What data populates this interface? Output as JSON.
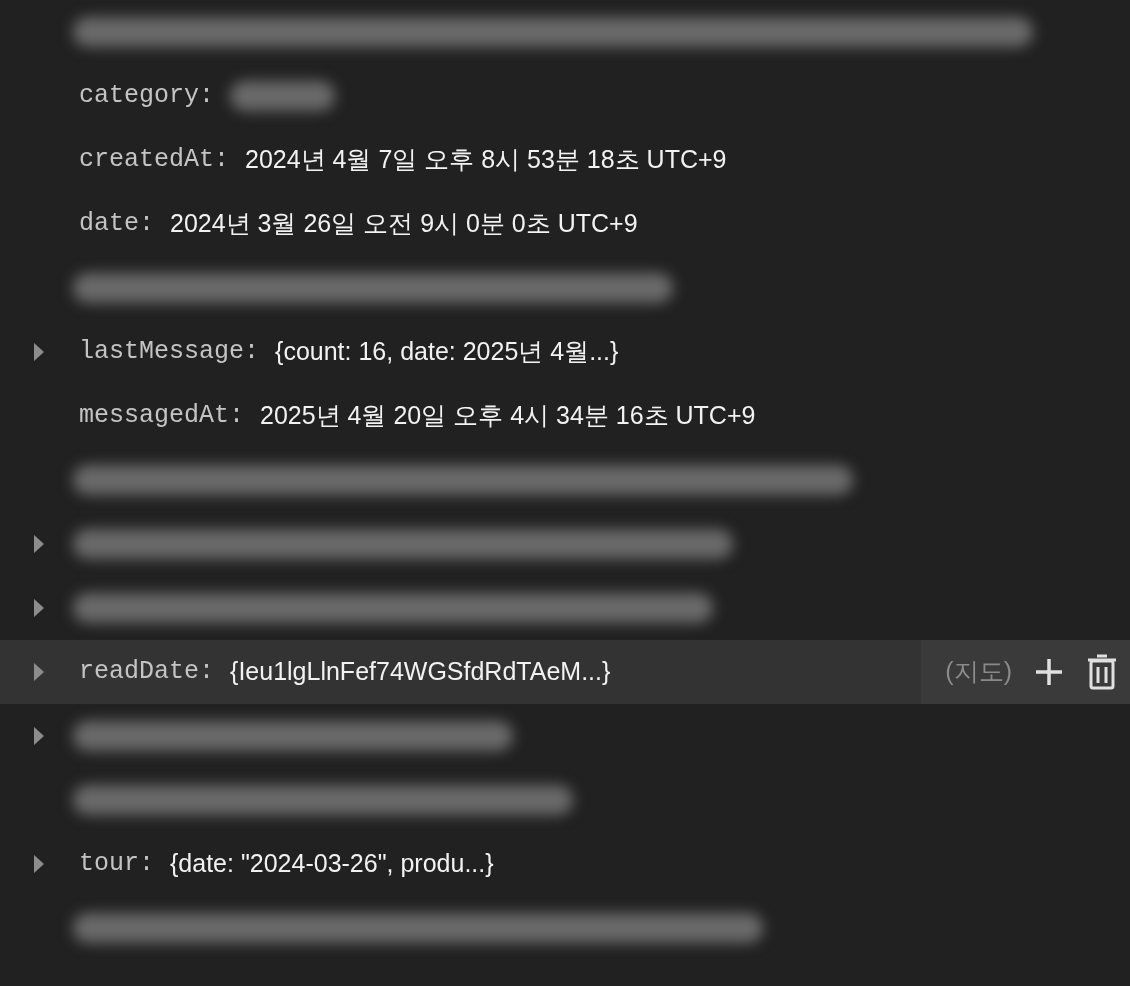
{
  "fields": [
    {
      "kind": "redacted",
      "expandable": false,
      "hovered": false
    },
    {
      "kind": "redacted_value",
      "key": "category:",
      "expandable": false,
      "hovered": false
    },
    {
      "kind": "field",
      "key": "createdAt:",
      "value": "2024년 4월 7일 오후 8시 53분 18초 UTC+9",
      "expandable": false,
      "hovered": false
    },
    {
      "kind": "field",
      "key": "date:",
      "value": "2024년 3월 26일 오전 9시 0분 0초 UTC+9",
      "expandable": false,
      "hovered": false
    },
    {
      "kind": "redacted",
      "expandable": false,
      "hovered": false
    },
    {
      "kind": "field",
      "key": "lastMessage:",
      "value": "{count: 16, date: 2025년 4월...}",
      "expandable": true,
      "hovered": false
    },
    {
      "kind": "field",
      "key": "messagedAt:",
      "value": "2025년 4월 20일 오후 4시 34분 16초 UTC+9",
      "expandable": false,
      "hovered": false
    },
    {
      "kind": "redacted",
      "expandable": false,
      "hovered": false
    },
    {
      "kind": "redacted",
      "expandable": true,
      "hovered": false
    },
    {
      "kind": "redacted",
      "expandable": true,
      "hovered": false
    },
    {
      "kind": "field",
      "key": "readDate:",
      "value": "{Ieu1lgLlnFef74WGSfdRdTAeM...}",
      "expandable": true,
      "hovered": true,
      "type_label": "(지도)"
    },
    {
      "kind": "redacted",
      "expandable": true,
      "hovered": false
    },
    {
      "kind": "redacted",
      "expandable": false,
      "hovered": false
    },
    {
      "kind": "field",
      "key": "tour:",
      "value": "{date: \"2024-03-26\", produ...}",
      "expandable": true,
      "hovered": false
    },
    {
      "kind": "redacted",
      "expandable": false,
      "hovered": false
    }
  ]
}
